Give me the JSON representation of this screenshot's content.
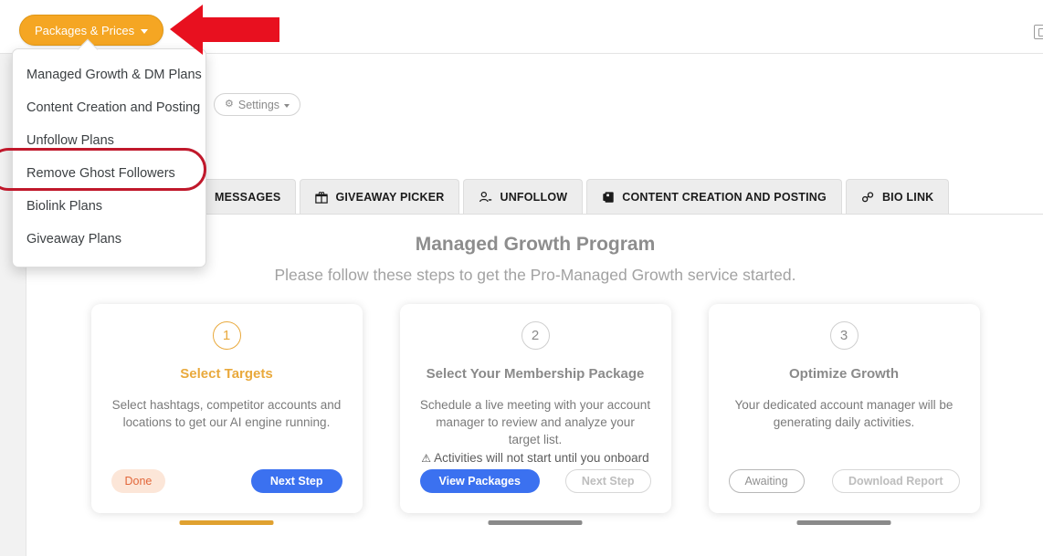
{
  "header": {
    "packages_button": {
      "label": "Packages & Prices",
      "caret_icon": "chevron-down-icon",
      "bg_color": "#f5a623"
    },
    "right_icon": "external-window-icon"
  },
  "dropdown": {
    "items": [
      {
        "label": "Managed Growth & DM Plans"
      },
      {
        "label": "Content Creation and Posting"
      },
      {
        "label": "Unfollow Plans"
      },
      {
        "label": "Remove Ghost Followers",
        "highlighted": true
      },
      {
        "label": "Biolink Plans"
      },
      {
        "label": "Giveaway Plans"
      }
    ]
  },
  "annotation": {
    "arrow_color": "#e8101f",
    "highlight_color": "#c0182b",
    "arrow_icon": "left-arrow-annotation",
    "highlight_icon": "oval-highlight-annotation"
  },
  "toolbar": {
    "settings_label": "Settings",
    "settings_icon": "gear-icon",
    "settings_caret": "chevron-down-icon"
  },
  "tabs": [
    {
      "label": "MESSAGES",
      "icon": ""
    },
    {
      "label": "GIVEAWAY PICKER",
      "icon": "gift-icon"
    },
    {
      "label": "UNFOLLOW",
      "icon": "user-minus-icon"
    },
    {
      "label": "CONTENT CREATION AND POSTING",
      "icon": "layers-icon"
    },
    {
      "label": "BIO LINK",
      "icon": "link-icon"
    }
  ],
  "main": {
    "title": "Managed Growth Program",
    "subtitle": "Please follow these steps to get the Pro-Managed Growth service started.",
    "accent_color": "#e9a93c",
    "primary_color": "#3b71f0",
    "cards": [
      {
        "number": "1",
        "title": "Select Targets",
        "description": "Select hashtags, competitor accounts and locations to get our AI engine running.",
        "warning": "",
        "left_button": "Done",
        "right_button": "Next Step",
        "state": "active"
      },
      {
        "number": "2",
        "title": "Select Your Membership Package",
        "description": "Schedule a live meeting with your account manager to review and analyze your target list.",
        "warning": "Activities will not start until you onboard",
        "warning_icon": "warning-triangle-icon",
        "left_button": "View Packages",
        "right_button": "Next Step",
        "state": "pending"
      },
      {
        "number": "3",
        "title": "Optimize Growth",
        "description": "Your dedicated account manager will be generating daily activities.",
        "warning": "",
        "left_button": "Awaiting",
        "right_button": "Download Report",
        "state": "pending"
      }
    ]
  }
}
